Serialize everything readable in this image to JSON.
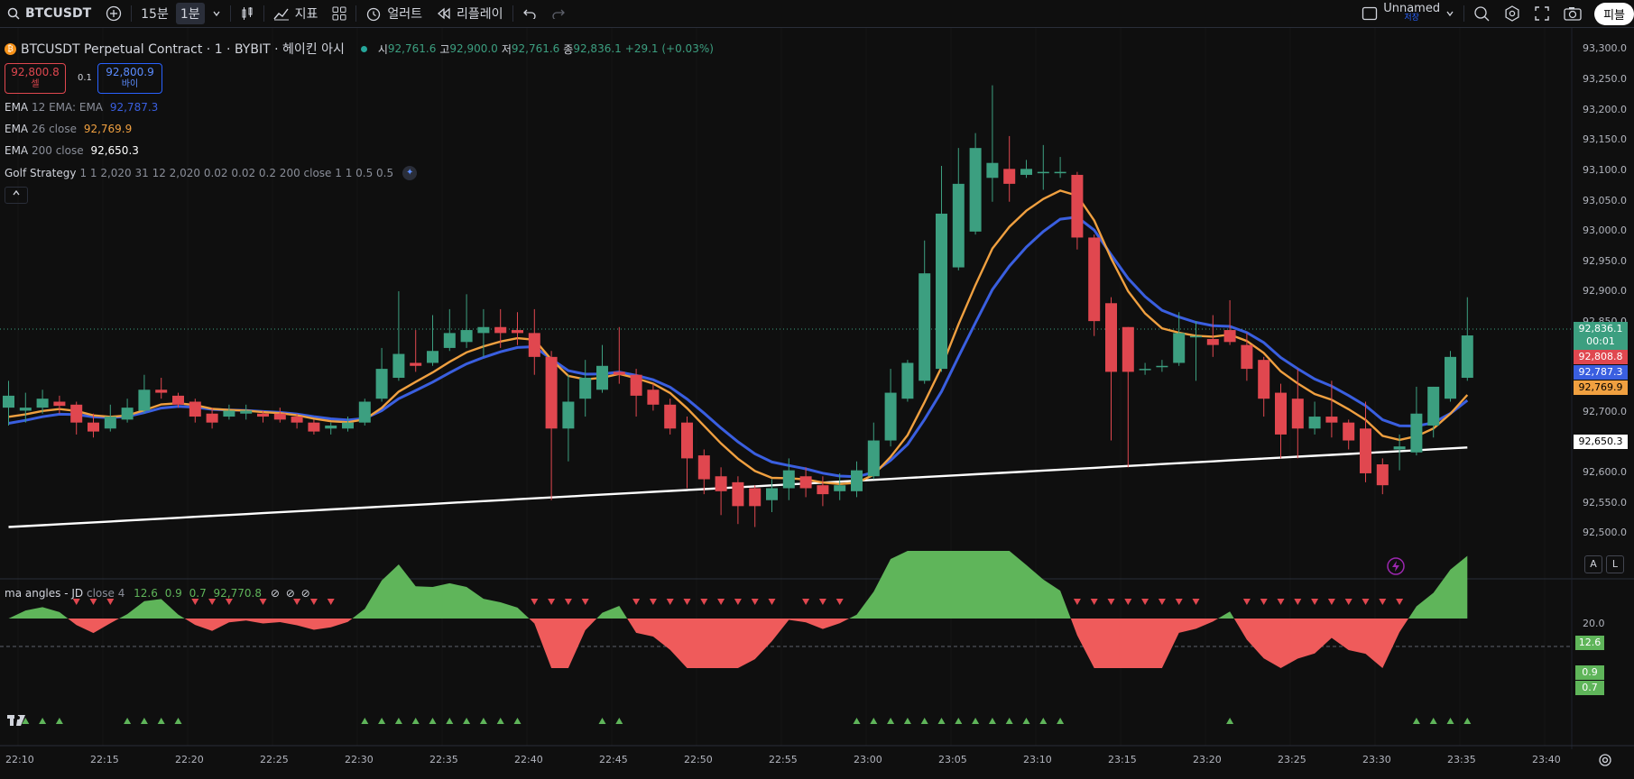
{
  "toolbar": {
    "symbol": "BTCUSDT",
    "interval_15m": "15분",
    "interval_1m": "1분",
    "indicators": "지표",
    "alert": "얼러트",
    "replay": "리플레이",
    "layout_name": "Unnamed",
    "layout_saved": "저장",
    "publish": "피블"
  },
  "header": {
    "title": "BTCUSDT Perpetual Contract · 1 · BYBIT · 헤이킨 아시",
    "o_label": "시",
    "o": "92,761.6",
    "h_label": "고",
    "h": "92,900.0",
    "l_label": "저",
    "l": "92,761.6",
    "c_label": "종",
    "c": "92,836.1",
    "change": "+29.1 (+0.03%)"
  },
  "trade": {
    "sell_price": "92,800.8",
    "sell_label": "셀",
    "spread": "0.1",
    "buy_price": "92,800.9",
    "buy_label": "바이"
  },
  "indicators": {
    "ema12": {
      "name": "EMA",
      "params": "12 EMA: EMA",
      "value": "92,787.3"
    },
    "ema26": {
      "name": "EMA",
      "params": "26 close",
      "value": "92,769.9"
    },
    "ema200": {
      "name": "EMA",
      "params": "200 close",
      "value": "92,650.3"
    },
    "golf": {
      "name": "Golf Strategy",
      "params": "1 1 2,020 31 12 2,020 0.02 0.02 0.2 200 close 1 1 0.5 0.5"
    },
    "ma_angles": {
      "name": "ma angles - JD",
      "params": "close 4",
      "v1": "12.6",
      "v2": "0.9",
      "v3": "0.7",
      "v4": "92,770.8"
    }
  },
  "price_axis": {
    "labels": [
      "93,300.0",
      "93,250.0",
      "93,200.0",
      "93,150.0",
      "93,100.0",
      "93,050.0",
      "93,000.0",
      "92,950.0",
      "92,900.0",
      "92,850.0",
      "92,700.0",
      "92,600.0",
      "92,550.0",
      "92,500.0"
    ],
    "last_price": "92,836.1",
    "countdown": "00:01",
    "sell_tag": "92,808.8",
    "ema12_tag": "92,787.3",
    "ema26_tag": "92,769.9",
    "ema200_tag": "92,650.3"
  },
  "osc_axis": {
    "top": "20.0",
    "tag1": "12.6",
    "tag2": "0.9",
    "tag3": "0.7"
  },
  "time_axis": [
    "22:10",
    "22:15",
    "22:20",
    "22:25",
    "22:30",
    "22:35",
    "22:40",
    "22:45",
    "22:50",
    "22:55",
    "23:00",
    "23:05",
    "23:10",
    "23:15",
    "23:20",
    "23:25",
    "23:30",
    "23:35",
    "23:40"
  ],
  "buttons": {
    "auto": "A",
    "log": "L"
  },
  "colors": {
    "up": "#3c9f80",
    "down": "#e0474f",
    "ema12": "#3a5fe0",
    "ema26": "#f0a040",
    "ema200": "#ffffff",
    "osc_pos": "#5fb55a",
    "osc_neg": "#ef5b5b",
    "osc_deep": "#8b1a4a"
  },
  "chart_data": {
    "type": "candlestick",
    "ylim": [
      92475,
      93330
    ],
    "candles": [
      {
        "o": 92715,
        "c": 92735,
        "h": 92760,
        "l": 92685
      },
      {
        "o": 92710,
        "c": 92715,
        "h": 92740,
        "l": 92690
      },
      {
        "o": 92715,
        "c": 92730,
        "h": 92745,
        "l": 92705
      },
      {
        "o": 92725,
        "c": 92718,
        "h": 92735,
        "l": 92705
      },
      {
        "o": 92720,
        "c": 92690,
        "h": 92725,
        "l": 92670
      },
      {
        "o": 92690,
        "c": 92675,
        "h": 92705,
        "l": 92665
      },
      {
        "o": 92680,
        "c": 92700,
        "h": 92720,
        "l": 92675
      },
      {
        "o": 92695,
        "c": 92715,
        "h": 92730,
        "l": 92690
      },
      {
        "o": 92710,
        "c": 92745,
        "h": 92770,
        "l": 92705
      },
      {
        "o": 92745,
        "c": 92740,
        "h": 92765,
        "l": 92730
      },
      {
        "o": 92735,
        "c": 92720,
        "h": 92740,
        "l": 92715
      },
      {
        "o": 92725,
        "c": 92700,
        "h": 92730,
        "l": 92690
      },
      {
        "o": 92705,
        "c": 92690,
        "h": 92715,
        "l": 92680
      },
      {
        "o": 92700,
        "c": 92710,
        "h": 92720,
        "l": 92695
      },
      {
        "o": 92705,
        "c": 92710,
        "h": 92720,
        "l": 92695
      },
      {
        "o": 92705,
        "c": 92700,
        "h": 92710,
        "l": 92690
      },
      {
        "o": 92705,
        "c": 92695,
        "h": 92715,
        "l": 92690
      },
      {
        "o": 92700,
        "c": 92690,
        "h": 92705,
        "l": 92680
      },
      {
        "o": 92690,
        "c": 92675,
        "h": 92695,
        "l": 92670
      },
      {
        "o": 92680,
        "c": 92685,
        "h": 92690,
        "l": 92670
      },
      {
        "o": 92680,
        "c": 92690,
        "h": 92700,
        "l": 92675
      },
      {
        "o": 92690,
        "c": 92725,
        "h": 92730,
        "l": 92685
      },
      {
        "o": 92730,
        "c": 92780,
        "h": 92815,
        "l": 92725
      },
      {
        "o": 92765,
        "c": 92805,
        "h": 92910,
        "l": 92760
      },
      {
        "o": 92790,
        "c": 92785,
        "h": 92845,
        "l": 92775
      },
      {
        "o": 92790,
        "c": 92810,
        "h": 92870,
        "l": 92785
      },
      {
        "o": 92815,
        "c": 92840,
        "h": 92880,
        "l": 92810
      },
      {
        "o": 92825,
        "c": 92845,
        "h": 92905,
        "l": 92815
      },
      {
        "o": 92840,
        "c": 92850,
        "h": 92880,
        "l": 92800
      },
      {
        "o": 92850,
        "c": 92840,
        "h": 92880,
        "l": 92815
      },
      {
        "o": 92845,
        "c": 92840,
        "h": 92875,
        "l": 92820
      },
      {
        "o": 92840,
        "c": 92800,
        "h": 92880,
        "l": 92770
      },
      {
        "o": 92800,
        "c": 92680,
        "h": 92810,
        "l": 92560
      },
      {
        "o": 92680,
        "c": 92725,
        "h": 92770,
        "l": 92625
      },
      {
        "o": 92730,
        "c": 92765,
        "h": 92795,
        "l": 92700
      },
      {
        "o": 92745,
        "c": 92785,
        "h": 92820,
        "l": 92740
      },
      {
        "o": 92775,
        "c": 92770,
        "h": 92850,
        "l": 92755
      },
      {
        "o": 92770,
        "c": 92735,
        "h": 92780,
        "l": 92700
      },
      {
        "o": 92745,
        "c": 92720,
        "h": 92755,
        "l": 92710
      },
      {
        "o": 92720,
        "c": 92680,
        "h": 92730,
        "l": 92670
      },
      {
        "o": 92690,
        "c": 92630,
        "h": 92700,
        "l": 92580
      },
      {
        "o": 92635,
        "c": 92595,
        "h": 92645,
        "l": 92570
      },
      {
        "o": 92600,
        "c": 92575,
        "h": 92615,
        "l": 92535
      },
      {
        "o": 92590,
        "c": 92550,
        "h": 92600,
        "l": 92520
      },
      {
        "o": 92580,
        "c": 92550,
        "h": 92585,
        "l": 92515
      },
      {
        "o": 92560,
        "c": 92580,
        "h": 92595,
        "l": 92540
      },
      {
        "o": 92580,
        "c": 92610,
        "h": 92630,
        "l": 92560
      },
      {
        "o": 92600,
        "c": 92580,
        "h": 92615,
        "l": 92565
      },
      {
        "o": 92585,
        "c": 92570,
        "h": 92600,
        "l": 92550
      },
      {
        "o": 92575,
        "c": 92585,
        "h": 92605,
        "l": 92560
      },
      {
        "o": 92575,
        "c": 92610,
        "h": 92625,
        "l": 92565
      },
      {
        "o": 92600,
        "c": 92660,
        "h": 92690,
        "l": 92595
      },
      {
        "o": 92660,
        "c": 92740,
        "h": 92780,
        "l": 92650
      },
      {
        "o": 92730,
        "c": 92790,
        "h": 92795,
        "l": 92725
      },
      {
        "o": 92760,
        "c": 92940,
        "h": 92995,
        "l": 92755
      },
      {
        "o": 92780,
        "c": 93040,
        "h": 93120,
        "l": 92775
      },
      {
        "o": 92950,
        "c": 93090,
        "h": 93150,
        "l": 92945
      },
      {
        "o": 93010,
        "c": 93150,
        "h": 93175,
        "l": 93005
      },
      {
        "o": 93100,
        "c": 93125,
        "h": 93255,
        "l": 93060
      },
      {
        "o": 93115,
        "c": 93090,
        "h": 93170,
        "l": 93060
      },
      {
        "o": 93105,
        "c": 93115,
        "h": 93130,
        "l": 93100
      },
      {
        "o": 93110,
        "c": 93110,
        "h": 93155,
        "l": 93080
      },
      {
        "o": 93110,
        "c": 93110,
        "h": 93135,
        "l": 93100
      },
      {
        "o": 93105,
        "c": 93000,
        "h": 93110,
        "l": 92980
      },
      {
        "o": 93000,
        "c": 92860,
        "h": 93005,
        "l": 92835
      },
      {
        "o": 92890,
        "c": 92775,
        "h": 92900,
        "l": 92660
      },
      {
        "o": 92850,
        "c": 92775,
        "h": 92850,
        "l": 92615
      },
      {
        "o": 92780,
        "c": 92780,
        "h": 92790,
        "l": 92770
      },
      {
        "o": 92785,
        "c": 92785,
        "h": 92795,
        "l": 92775
      },
      {
        "o": 92790,
        "c": 92840,
        "h": 92875,
        "l": 92785
      },
      {
        "o": 92835,
        "c": 92835,
        "h": 92860,
        "l": 92760
      },
      {
        "o": 92830,
        "c": 92820,
        "h": 92870,
        "l": 92800
      },
      {
        "o": 92845,
        "c": 92825,
        "h": 92895,
        "l": 92820
      },
      {
        "o": 92820,
        "c": 92780,
        "h": 92840,
        "l": 92760
      },
      {
        "o": 92795,
        "c": 92730,
        "h": 92800,
        "l": 92700
      },
      {
        "o": 92740,
        "c": 92670,
        "h": 92755,
        "l": 92630
      },
      {
        "o": 92730,
        "c": 92680,
        "h": 92780,
        "l": 92630
      },
      {
        "o": 92680,
        "c": 92700,
        "h": 92725,
        "l": 92670
      },
      {
        "o": 92700,
        "c": 92690,
        "h": 92760,
        "l": 92665
      },
      {
        "o": 92690,
        "c": 92660,
        "h": 92695,
        "l": 92645
      },
      {
        "o": 92680,
        "c": 92605,
        "h": 92725,
        "l": 92590
      },
      {
        "o": 92620,
        "c": 92585,
        "h": 92630,
        "l": 92570
      },
      {
        "o": 92645,
        "c": 92650,
        "h": 92670,
        "l": 92610
      },
      {
        "o": 92640,
        "c": 92705,
        "h": 92750,
        "l": 92635
      },
      {
        "o": 92685,
        "c": 92750,
        "h": 92750,
        "l": 92665
      },
      {
        "o": 92730,
        "c": 92800,
        "h": 92810,
        "l": 92725
      },
      {
        "o": 92765,
        "c": 92836,
        "h": 92900,
        "l": 92760
      }
    ]
  }
}
